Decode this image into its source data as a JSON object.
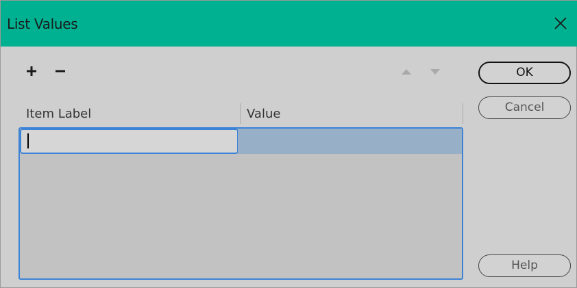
{
  "window": {
    "title": "List Values",
    "accent_color": "#00b191",
    "close_icon": "close-icon"
  },
  "toolbar": {
    "add_icon": "plus-icon",
    "remove_icon": "minus-icon",
    "move_up_icon": "arrow-up-icon",
    "move_down_icon": "arrow-down-icon"
  },
  "grid": {
    "columns": [
      "Item Label",
      "Value"
    ],
    "rows": [
      {
        "label": "",
        "value": ""
      }
    ],
    "selection_color": "#98afc8",
    "focus_color": "#3c83d6"
  },
  "buttons": {
    "ok": "OK",
    "cancel": "Cancel",
    "help": "Help"
  }
}
